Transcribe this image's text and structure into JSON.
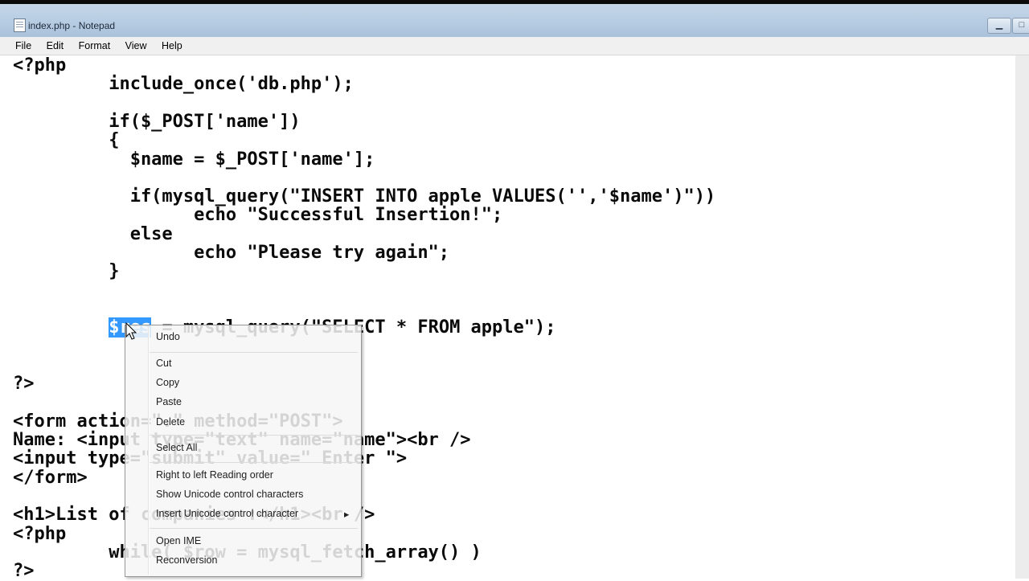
{
  "window": {
    "title": "index.php - Notepad",
    "buttons": [
      "minimize-button",
      "maximize-button",
      "close-button"
    ]
  },
  "menu": {
    "items": [
      "File",
      "Edit",
      "Format",
      "View",
      "Help"
    ]
  },
  "code": {
    "lines": [
      "<?php",
      "         include_once('db.php');",
      "",
      "         if($_POST['name'])",
      "         {",
      "           $name = $_POST['name'];",
      "",
      "           if(mysql_query(\"INSERT INTO apple VALUES('','$name')\"))",
      "                 echo \"Successful Insertion!\";",
      "           else",
      "                 echo \"Please try again\";",
      "         }",
      "",
      "",
      "         $res = mysql_query(\"SELECT * FROM apple\");",
      "",
      "",
      "?>",
      "",
      "<form action=\".\" method=\"POST\">",
      "Name: <input type=\"text\" name=\"name\"><br />",
      "<input type=\"submit\" value=\" Enter \">",
      "</form>",
      "",
      "<h1>List of companies :</h1><br />",
      "<?php",
      "         while( $row = mysql_fetch_array() )",
      "?>"
    ],
    "selected_text": "$res",
    "selected_line": 14
  },
  "context_menu": {
    "items": [
      {
        "label": "Undo"
      },
      {
        "label": "Cut"
      },
      {
        "label": "Copy"
      },
      {
        "label": "Paste"
      },
      {
        "label": "Delete"
      },
      {
        "label": "Select All"
      },
      {
        "label": "Right to left Reading order"
      },
      {
        "label": "Show Unicode control characters"
      },
      {
        "label": "Insert Unicode control character"
      },
      {
        "label": "Open IME"
      },
      {
        "label": "Reconversion"
      }
    ],
    "submenu_arrow": "▸"
  }
}
